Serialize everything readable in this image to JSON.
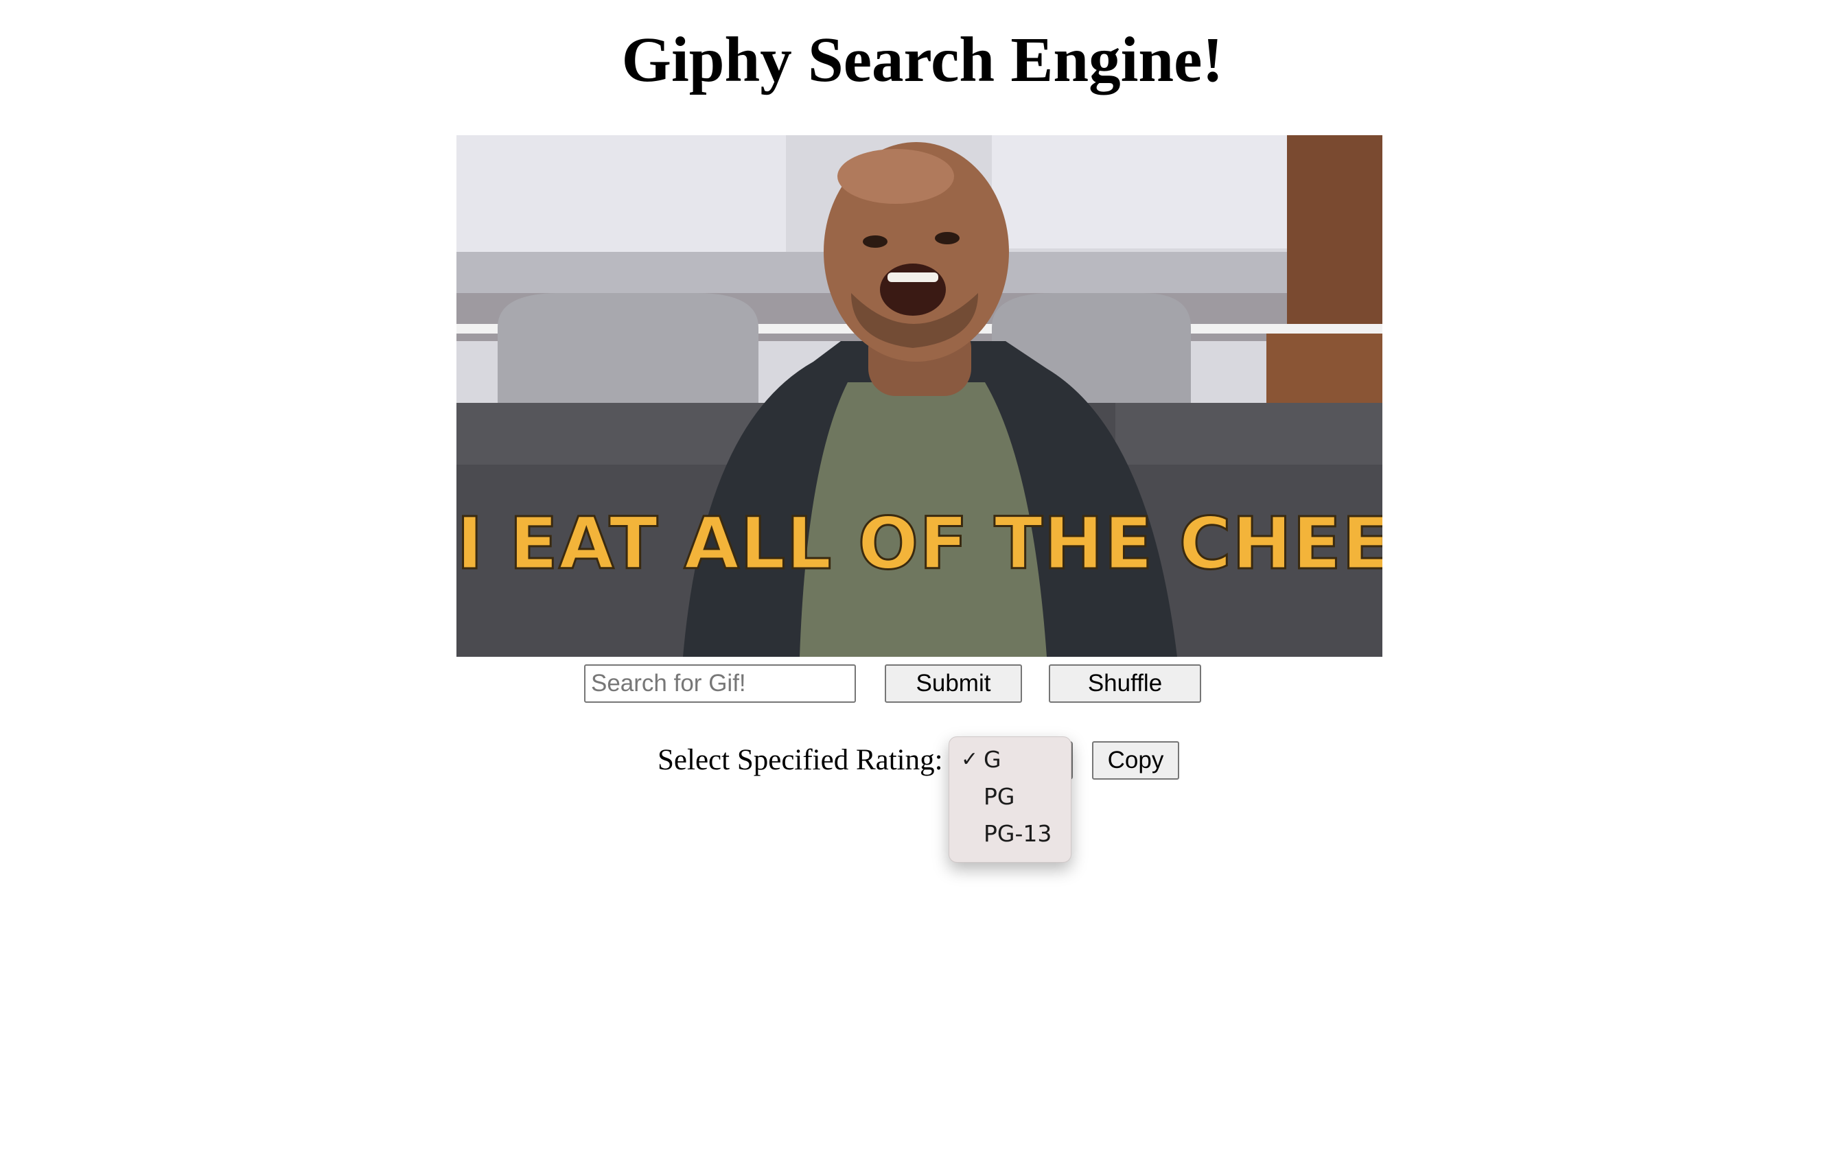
{
  "page": {
    "title": "Giphy Search Engine!"
  },
  "gif": {
    "caption": "I EAT ALL OF THE CHEESE"
  },
  "search": {
    "placeholder": "Search for Gif!",
    "value": ""
  },
  "buttons": {
    "submit_label": "Submit",
    "shuffle_label": "Shuffle",
    "copy_label": "Copy"
  },
  "rating": {
    "label": "Select Specified Rating:",
    "selected": "G",
    "options": [
      "G",
      "PG",
      "PG-13"
    ],
    "check_glyph": "✓"
  },
  "colors": {
    "caption_text": "#f3b43a",
    "dropdown_background": "#ebe4e4",
    "button_background": "#efefef"
  }
}
